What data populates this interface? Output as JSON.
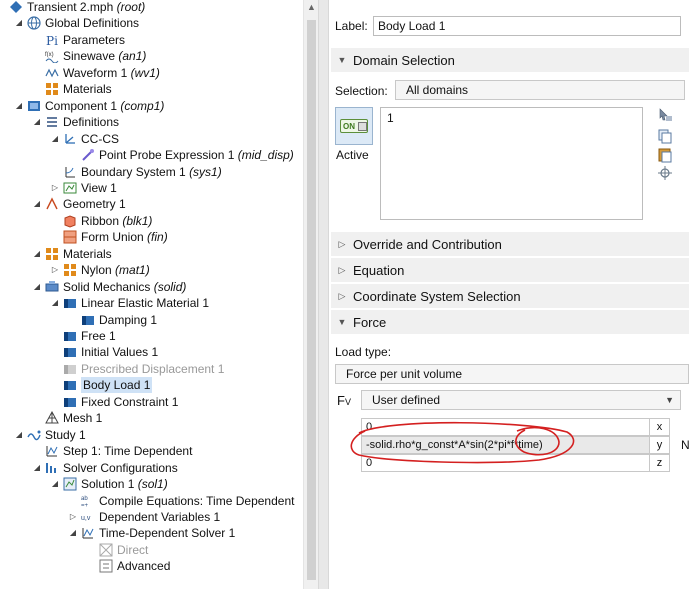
{
  "tree": [
    {
      "label": "Transient 2.mph",
      "tag": "(root)",
      "icon": "root-model-icon",
      "expander": "none"
    },
    {
      "label": "Global Definitions",
      "tag": "",
      "icon": "globe-icon",
      "expander": "open"
    },
    {
      "label": "Parameters",
      "tag": "",
      "icon": "parameters-pi-icon",
      "expander": "none"
    },
    {
      "label": "Sinewave",
      "tag": "(an1)",
      "icon": "analytic-function-icon",
      "expander": "none"
    },
    {
      "label": "Waveform 1",
      "tag": "(wv1)",
      "icon": "waveform-icon",
      "expander": "none"
    },
    {
      "label": "Materials",
      "tag": "",
      "icon": "materials-icon",
      "expander": "none"
    },
    {
      "label": "Component 1",
      "tag": "(comp1)",
      "icon": "component-icon",
      "expander": "open"
    },
    {
      "label": "Definitions",
      "tag": "",
      "icon": "definitions-icon",
      "expander": "open"
    },
    {
      "label": "CC-CS",
      "tag": "",
      "icon": "coordinate-system-icon",
      "expander": "open"
    },
    {
      "label": "Point Probe Expression 1",
      "tag": "(mid_disp)",
      "icon": "probe-icon",
      "expander": "none"
    },
    {
      "label": "Boundary System 1",
      "tag": "(sys1)",
      "icon": "boundary-system-icon",
      "expander": "none"
    },
    {
      "label": "View 1",
      "tag": "",
      "icon": "view-icon",
      "expander": "closed"
    },
    {
      "label": "Geometry 1",
      "tag": "",
      "icon": "geometry-icon",
      "expander": "open"
    },
    {
      "label": "Ribbon",
      "tag": "(blk1)",
      "icon": "block-icon",
      "expander": "none"
    },
    {
      "label": "Form Union",
      "tag": "(fin)",
      "icon": "form-union-icon",
      "expander": "none"
    },
    {
      "label": "Materials",
      "tag": "",
      "icon": "materials-icon",
      "expander": "open"
    },
    {
      "label": "Nylon",
      "tag": "(mat1)",
      "icon": "material-icon",
      "expander": "closed"
    },
    {
      "label": "Solid Mechanics",
      "tag": "(solid)",
      "icon": "solid-mechanics-icon",
      "expander": "open"
    },
    {
      "label": "Linear Elastic Material 1",
      "tag": "",
      "icon": "physics-feature-icon",
      "expander": "open"
    },
    {
      "label": "Damping 1",
      "tag": "",
      "icon": "physics-subfeature-icon",
      "expander": "none"
    },
    {
      "label": "Free 1",
      "tag": "",
      "icon": "physics-feature-icon",
      "expander": "none"
    },
    {
      "label": "Initial Values 1",
      "tag": "",
      "icon": "physics-feature-icon",
      "expander": "none"
    },
    {
      "label": "Prescribed Displacement 1",
      "tag": "",
      "icon": "physics-feature-disabled-icon",
      "expander": "none",
      "dim": true
    },
    {
      "label": "Body Load 1",
      "tag": "",
      "icon": "physics-feature-icon",
      "expander": "none",
      "selected": true
    },
    {
      "label": "Fixed Constraint 1",
      "tag": "",
      "icon": "physics-feature-icon",
      "expander": "none"
    },
    {
      "label": "Mesh 1",
      "tag": "",
      "icon": "mesh-icon",
      "expander": "none"
    },
    {
      "label": "Study 1",
      "tag": "",
      "icon": "study-icon",
      "expander": "open"
    },
    {
      "label": "Step 1: Time Dependent",
      "tag": "",
      "icon": "time-dependent-step-icon",
      "expander": "none"
    },
    {
      "label": "Solver Configurations",
      "tag": "",
      "icon": "solver-configurations-icon",
      "expander": "open"
    },
    {
      "label": "Solution 1",
      "tag": "(sol1)",
      "icon": "solution-icon",
      "expander": "open"
    },
    {
      "label": "Compile Equations: Time Dependent",
      "tag": "",
      "icon": "compile-equations-icon",
      "expander": "none"
    },
    {
      "label": "Dependent Variables 1",
      "tag": "",
      "icon": "dependent-variables-icon",
      "expander": "closed"
    },
    {
      "label": "Time-Dependent Solver 1",
      "tag": "",
      "icon": "time-dependent-solver-icon",
      "expander": "open"
    },
    {
      "label": "Direct",
      "tag": "",
      "icon": "direct-solver-icon",
      "expander": "none",
      "dim": true
    },
    {
      "label": "Advanced",
      "tag": "",
      "icon": "advanced-icon",
      "expander": "none"
    }
  ],
  "settings": {
    "label_caption": "Label:",
    "label_value": "Body Load 1",
    "domain_section": "Domain Selection",
    "selection_caption": "Selection:",
    "selection_value": "All domains",
    "domain_list": [
      "1"
    ],
    "active_caption": "Active",
    "toggle_text": "ON",
    "collapsed_sections": [
      "Override and Contribution",
      "Equation",
      "Coordinate System Selection"
    ],
    "force_section": "Force",
    "load_type_caption": "Load type:",
    "load_type_value": "Force per unit volume",
    "fv_symbol": "F",
    "fv_subscript": "V",
    "fv_mode": "User defined",
    "components": [
      {
        "value": "0",
        "axis": "x"
      },
      {
        "value": "-solid.rho*g_const*A*sin(2*pi*f*time)",
        "axis": "y"
      },
      {
        "value": "0",
        "axis": "z"
      }
    ],
    "unit": "N"
  },
  "annotation_color": "#d42020"
}
